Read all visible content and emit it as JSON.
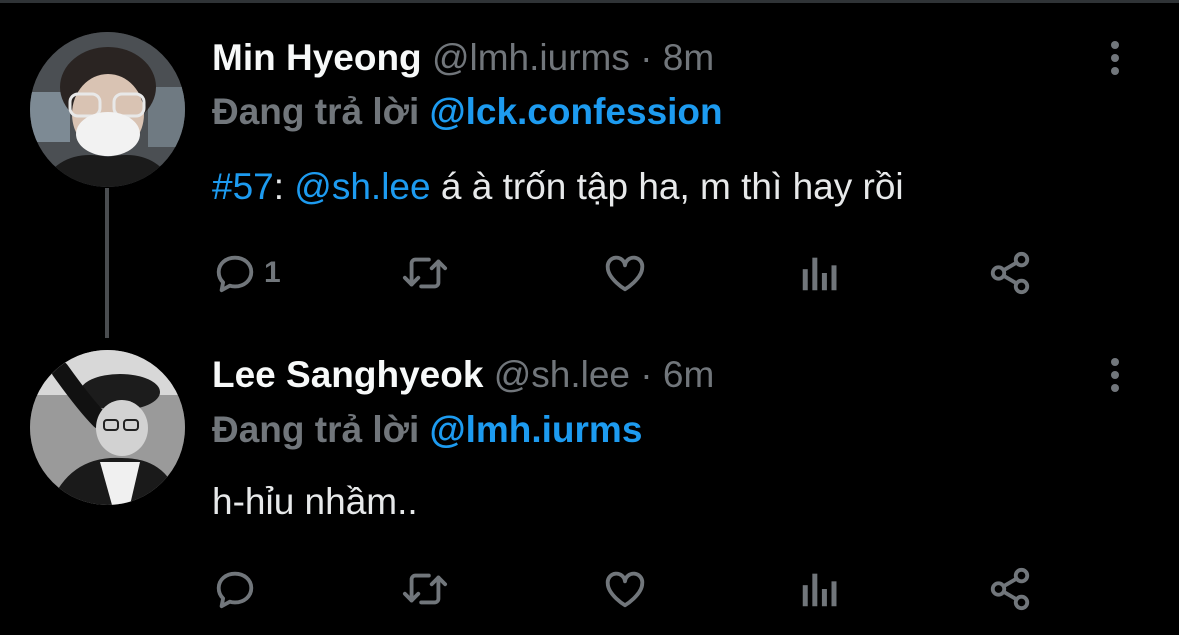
{
  "theme": {
    "background": "#000000",
    "accent": "#1d9bf0",
    "muted": "#71767b",
    "text": "#e7e9ea"
  },
  "tweets": [
    {
      "author_name": "Min Hyeong",
      "handle": "@lmh.iurms",
      "separator": "·",
      "time": "8m",
      "reply_prefix": "Đang trả lời",
      "reply_to": "@lck.confession",
      "body": {
        "hashtag": "#57",
        "colon": ": ",
        "mention": "@sh.lee",
        "text": " á à trốn tập ha, m thì hay rồi"
      },
      "reply_count": "1",
      "icons": [
        "reply-icon",
        "retweet-icon",
        "like-icon",
        "analytics-icon",
        "share-icon",
        "more-options-icon"
      ]
    },
    {
      "author_name": "Lee Sanghyeok",
      "handle": "@sh.lee",
      "separator": "·",
      "time": "6m",
      "reply_prefix": "Đang trả lời",
      "reply_to": "@lmh.iurms",
      "body": {
        "text": "h-hỉu nhầm.."
      },
      "reply_count": "",
      "icons": [
        "reply-icon",
        "retweet-icon",
        "like-icon",
        "analytics-icon",
        "share-icon",
        "more-options-icon"
      ]
    }
  ]
}
